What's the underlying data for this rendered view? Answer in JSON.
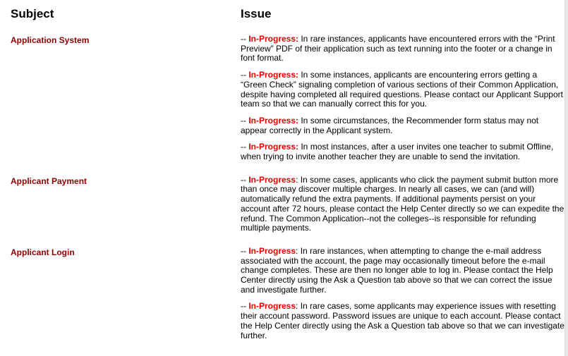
{
  "headers": {
    "subject": "Subject",
    "issue": "Issue"
  },
  "status_color": "#e60000",
  "subject_color": "#8b0000",
  "sections": [
    {
      "subject": "Application System",
      "issues": [
        {
          "prefix": "-- ",
          "status": "In-Progress:",
          "status_suffix": "",
          "text": " In rare instances, applicants have encountered errors with the “Print Preview” PDF of their application such as text running into the footer or a change in font format."
        },
        {
          "prefix": "-- ",
          "status": "In-Progress:",
          "status_suffix": "",
          "text": " In some instances, applicants are encountering errors getting a “Green Check” signaling completion of various sections of their Common Application, despite having completed all required questions. Please contact our Applicant Support team so that we can manually correct this for you."
        },
        {
          "prefix": "-- ",
          "status": "In-Progress:",
          "status_suffix": "",
          "text": " In some circumstances, the Recommender form status may not appear correctly in the Applicant system."
        },
        {
          "prefix": "-- ",
          "status": "In-Progress:",
          "status_suffix": "",
          "text": " In most instances, after a user invites one teacher to submit Offline, when trying to invite another teacher they are unable to send the invitation."
        }
      ]
    },
    {
      "subject": "Applicant Payment",
      "issues": [
        {
          "prefix": "-- ",
          "status": "In-Progress",
          "status_suffix": ":",
          "text": " In some cases, applicants who click the payment submit button more than once may discover multiple charges. In nearly all cases, we can (and will) automatically refund the extra payments.  If additional payments persist on your account after 72 hours, please contact the Help Center directly so we can expedite the refund. The Common Application--not the colleges--is responsible for refunding multiple payments."
        }
      ]
    },
    {
      "subject": "Applicant Login",
      "issues": [
        {
          "prefix": "-- ",
          "status": "In-Progress",
          "status_suffix": ":",
          "text": " In rare instances, when attempting to change the e-mail address associated with the account, the page may occasionally timeout before the e-mail change completes. These are then no longer able to log in. Please contact the Help Center directly using the Ask a Question tab above so that we can correct the issue and investigate further."
        },
        {
          "prefix": "-- ",
          "status": "In-Progress",
          "status_suffix": ":",
          "text": " In rare cases, some applicants may experience issues with resetting their account password. Password issues are unique to each account. Please contact the Help Center directly using the Ask a Question tab above so that we can investigate further."
        }
      ]
    }
  ]
}
